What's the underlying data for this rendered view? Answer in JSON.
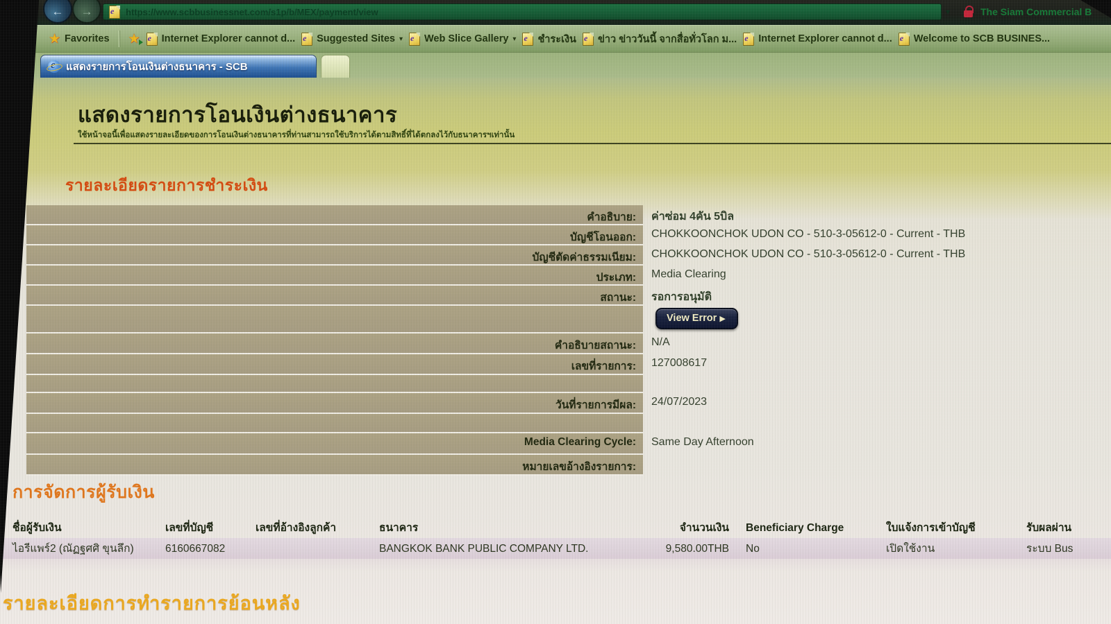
{
  "colors": {
    "chrome_green": "#176038",
    "favbar_green": "#96ad7a",
    "tab_blue": "#3e74b4",
    "section1_orange": "#d44b10",
    "section2_orange": "#e0761c",
    "section3_orange": "#eca81e",
    "label_cell_tan": "#a89e85",
    "button_navy": "#1b2440",
    "lock_red": "#c2263a",
    "row_highlight_pink": "#d9cdd6"
  },
  "icons": {
    "back_arrow": "←",
    "forward_arrow": "→",
    "caret_down": "▾",
    "star": "★",
    "view_error_caret": "▶"
  },
  "browser": {
    "url": "https://www.scbbusinessnet.com/s1p/b/MEX/payment/view",
    "secure_site_name": "The Siam Commercial B",
    "favorites_label": "Favorites",
    "favorites": [
      {
        "label": "Internet Explorer cannot d..."
      },
      {
        "label": "Suggested Sites"
      },
      {
        "label": "Web Slice Gallery"
      },
      {
        "label": "ชำระเงิน"
      },
      {
        "label": "ข่าว ข่าววันนี้ จากสื่อทั่วโลก ม..."
      },
      {
        "label": "Internet Explorer cannot d..."
      },
      {
        "label": "Welcome to SCB BUSINES..."
      }
    ],
    "tab_title": "แสดงรายการโอนเงินต่างธนาคาร - SCB"
  },
  "page": {
    "title": "แสดงรายการโอนเงินต่างธนาคาร",
    "subtitle": "ใช้หน้าจอนี้เพื่อแสดงรายละเอียดของการโอนเงินต่างธนาคารที่ท่านสามารถใช้บริการได้ตามสิทธิ์ที่ได้ตกลงไว้กับธนาคารฯเท่านั้น"
  },
  "payment": {
    "heading": "รายละเอียดรายการชำระเงิน",
    "view_error_label": "View Error",
    "rows": [
      {
        "label": "คำอธิบาย:",
        "value": "ค่าซ่อม 4คัน 5บิล"
      },
      {
        "label": "บัญชีโอนออก:",
        "value": "CHOKKOONCHOK UDON CO - 510-3-05612-0 - Current - THB"
      },
      {
        "label": "บัญชีตัดค่าธรรมเนียม:",
        "value": "CHOKKOONCHOK UDON CO - 510-3-05612-0 - Current - THB"
      },
      {
        "label": "ประเภท:",
        "value": "Media Clearing"
      },
      {
        "label": "สถานะ:",
        "value": "รอการอนุมัติ"
      },
      {
        "label": "",
        "value": ""
      },
      {
        "label": "คำอธิบายสถานะ:",
        "value": "N/A"
      },
      {
        "label": "เลขที่รายการ:",
        "value": "127008617"
      },
      {
        "label": "",
        "value": ""
      },
      {
        "label": "วันที่รายการมีผล:",
        "value": "24/07/2023"
      },
      {
        "label": "",
        "value": ""
      },
      {
        "label": "Media Clearing Cycle:",
        "value": "Same Day Afternoon"
      },
      {
        "label": "หมายเลขอ้างอิงรายการ:",
        "value": ""
      }
    ]
  },
  "beneficiary": {
    "heading": "การจัดการผู้รับเงิน",
    "columns": [
      "ชื่อผู้รับเงิน",
      "เลขที่บัญชี",
      "เลขที่อ้างอิงลูกค้า",
      "ธนาคาร",
      "จำนวนเงิน",
      "Beneficiary Charge",
      "ใบแจ้งการเข้าบัญชี",
      "รับผลผ่าน"
    ],
    "row": {
      "name": "ไอรีแพร์2 (ณัฏฐศศิ ขุนลึก)",
      "account": "6160667082",
      "customer_ref": "",
      "bank": "BANGKOK BANK PUBLIC COMPANY LTD.",
      "amount": "9,580.00THB",
      "beneficiary_charge": "No",
      "credit_advice": "เปิดใช้งาน",
      "received_via": "ระบบ Bus"
    }
  },
  "history": {
    "heading": "รายละเอียดการทำรายการย้อนหลัง"
  }
}
